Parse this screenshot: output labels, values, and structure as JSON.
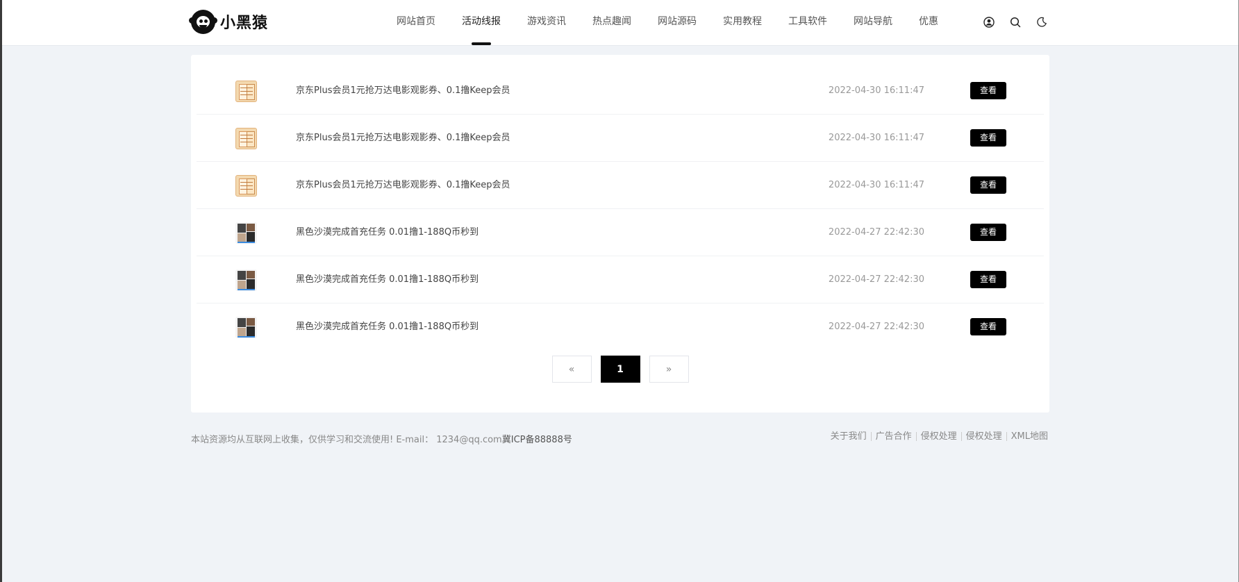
{
  "brand": {
    "name": "小黑猿"
  },
  "nav": {
    "items": [
      {
        "label": "网站首页"
      },
      {
        "label": "活动线报"
      },
      {
        "label": "游戏资讯"
      },
      {
        "label": "热点趣闻"
      },
      {
        "label": "网站源码"
      },
      {
        "label": "实用教程"
      },
      {
        "label": "工具软件"
      },
      {
        "label": "网站导航"
      },
      {
        "label": "优惠"
      }
    ],
    "active": "活动线报"
  },
  "header_icons": [
    "user-icon",
    "search-icon",
    "dark-mode-icon"
  ],
  "list": {
    "rows": [
      {
        "thumb": "orange",
        "title": "京东Plus会员1元抢万达电影观影券、0.1撸Keep会员",
        "date": "2022-04-30 16:11:47",
        "button": "查看"
      },
      {
        "thumb": "orange",
        "title": "京东Plus会员1元抢万达电影观影券、0.1撸Keep会员",
        "date": "2022-04-30 16:11:47",
        "button": "查看"
      },
      {
        "thumb": "orange",
        "title": "京东Plus会员1元抢万达电影观影券、0.1撸Keep会员",
        "date": "2022-04-30 16:11:47",
        "button": "查看"
      },
      {
        "thumb": "dark",
        "title": "黑色沙漠完成首充任务 0.01撸1-188Q币秒到",
        "date": "2022-04-27 22:42:30",
        "button": "查看"
      },
      {
        "thumb": "dark",
        "title": "黑色沙漠完成首充任务 0.01撸1-188Q币秒到",
        "date": "2022-04-27 22:42:30",
        "button": "查看"
      },
      {
        "thumb": "dark",
        "title": "黑色沙漠完成首充任务 0.01撸1-188Q币秒到",
        "date": "2022-04-27 22:42:30",
        "button": "查看"
      }
    ]
  },
  "pagination": {
    "prev": "«",
    "current": "1",
    "next": "»"
  },
  "footer": {
    "notice": "本站资源均从互联网上收集，仅供学习和交流使用! E-mail： 1234@qq.com",
    "icp": "冀ICP备88888号",
    "links": [
      "关于我们",
      "广告合作",
      "侵权处理",
      "侵权处理",
      "XML地图"
    ]
  },
  "colors": {
    "accent": "#000000",
    "page_bg": "#f0f3f7",
    "card_bg": "#ffffff",
    "muted_text": "#999999"
  }
}
